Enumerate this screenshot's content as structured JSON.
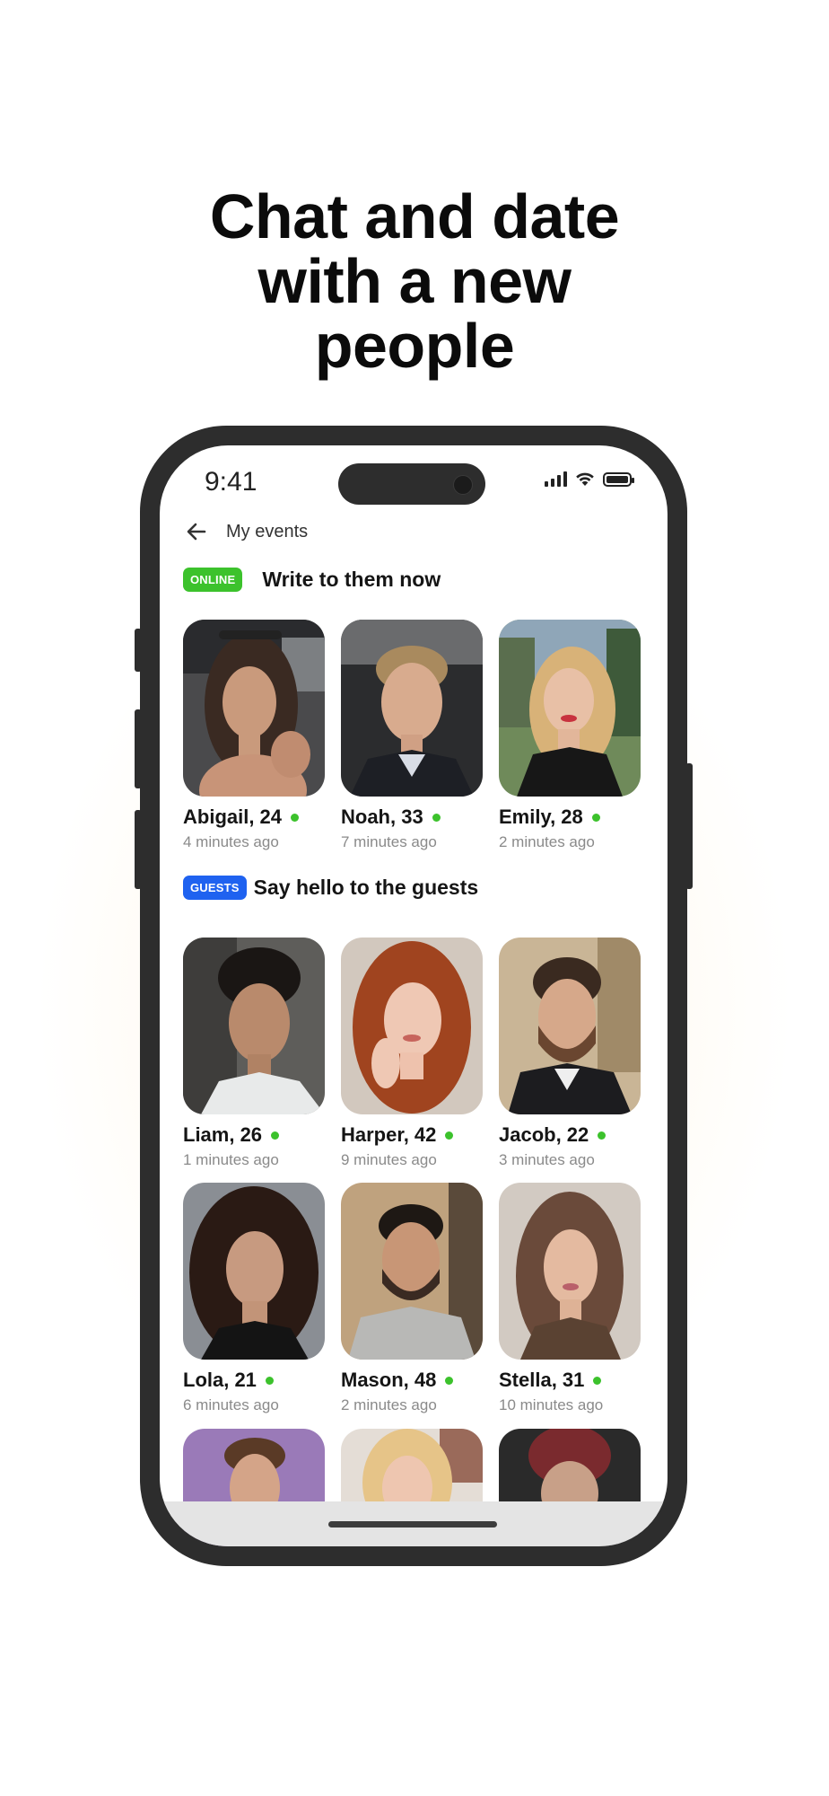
{
  "headline": {
    "line1": "Chat and date",
    "line2": "with a new",
    "line3": "people"
  },
  "status_bar": {
    "time": "9:41",
    "icons": [
      "signal-icon",
      "wifi-icon",
      "battery-icon"
    ]
  },
  "nav": {
    "back_icon": "arrow-left-icon",
    "title": "My events"
  },
  "sections": [
    {
      "badge": "ONLINE",
      "badge_color": "#3cc22c",
      "title": "Write to them now",
      "people": [
        {
          "name": "Abigail, 24",
          "ago": "4 minutes ago",
          "online": true
        },
        {
          "name": "Noah, 33",
          "ago": "7 minutes ago",
          "online": true
        },
        {
          "name": "Emily, 28",
          "ago": "2 minutes ago",
          "online": true
        }
      ]
    },
    {
      "badge": "GUESTS",
      "badge_color": "#1f62f0",
      "title": "Say hello to the guests",
      "people": [
        {
          "name": "Liam, 26",
          "ago": "1 minutes ago",
          "online": true
        },
        {
          "name": "Harper, 42",
          "ago": "9 minutes ago",
          "online": true
        },
        {
          "name": "Jacob, 22",
          "ago": "3 minutes ago",
          "online": true
        },
        {
          "name": "Lola, 21",
          "ago": "6 minutes ago",
          "online": true
        },
        {
          "name": "Mason, 48",
          "ago": "2 minutes ago",
          "online": true
        },
        {
          "name": "Stella, 31",
          "ago": "10 minutes ago",
          "online": true
        }
      ]
    }
  ],
  "colors": {
    "online_dot": "#3cc22c",
    "phone_frame": "#2d2d2d"
  }
}
